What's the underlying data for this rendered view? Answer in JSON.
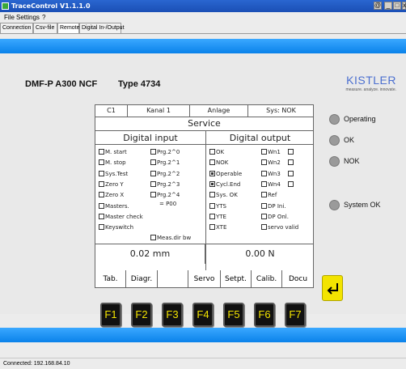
{
  "window": {
    "title": "TraceControl V1.1.1.0",
    "min_btn": "_",
    "max_btn": "□",
    "close_btn": "x",
    "sys_btn": "@"
  },
  "menu": [
    "File",
    "Settings",
    "?"
  ],
  "tabs": [
    "Connection",
    "Csv-file",
    "Remote",
    "Digital In-/Output"
  ],
  "active_tab": "Remote",
  "device": {
    "name": "DMF-P A300 NCF",
    "type": "Type 4734"
  },
  "logo": {
    "brand": "KISTLER",
    "tagline": "measure. analyze. innovate."
  },
  "lcd": {
    "header": [
      "C1",
      "Kanal 1",
      "Anlage",
      "Sys: NOK"
    ],
    "title": "Service",
    "digital_input_title": "Digital input",
    "digital_output_title": "Digital output",
    "inputs_left": [
      {
        "label": "M. start",
        "checked": false
      },
      {
        "label": "M. stop",
        "checked": false
      },
      {
        "label": "Sys.Test",
        "checked": false
      },
      {
        "label": "Zero Y",
        "checked": false
      },
      {
        "label": "Zero X",
        "checked": false
      },
      {
        "label": "Masters.",
        "checked": false
      },
      {
        "label": "Master check",
        "checked": false
      },
      {
        "label": "Keyswitch",
        "checked": false
      }
    ],
    "inputs_right": [
      {
        "label": "Prg.2^0",
        "checked": false
      },
      {
        "label": "Prg.2^1",
        "checked": false
      },
      {
        "label": "Prg.2^2",
        "checked": false
      },
      {
        "label": "Prg.2^3",
        "checked": false
      },
      {
        "label": "Prg.2^4",
        "checked": false
      }
    ],
    "masters_value": "= P00",
    "measdir": "Meas.dir bw",
    "outputs_left": [
      {
        "label": "OK",
        "checked": false
      },
      {
        "label": "NOK",
        "checked": false
      },
      {
        "label": "Operable",
        "checked": true
      },
      {
        "label": "Cycl.End",
        "checked": true
      },
      {
        "label": "Sys. OK",
        "checked": false
      },
      {
        "label": "YTS",
        "checked": false
      },
      {
        "label": "YTE",
        "checked": false
      },
      {
        "label": "XTE",
        "checked": false
      }
    ],
    "outputs_right": [
      {
        "label": "Wn1",
        "checked": false
      },
      {
        "label": "Wn2",
        "checked": false
      },
      {
        "label": "Wn3",
        "checked": false
      },
      {
        "label": "Wn4",
        "checked": false
      },
      {
        "label": "Ref",
        "checked": false
      },
      {
        "label": "DP Ini.",
        "checked": false
      },
      {
        "label": "DP Onl.",
        "checked": false
      },
      {
        "label": "servo valid",
        "checked": false
      }
    ],
    "position_value": "0.02 mm",
    "force_value": "0.00 N",
    "softkeys": [
      "Tab.",
      "Diagr.",
      "",
      "Servo",
      "Setpt.",
      "Calib.",
      "Docu"
    ]
  },
  "fkeys": [
    "F1",
    "F2",
    "F3",
    "F4",
    "F5",
    "F6",
    "F7"
  ],
  "status_leds": [
    {
      "label": "Operating",
      "color": "#9a9a9a"
    },
    {
      "label": "OK",
      "color": "#9a9a9a"
    },
    {
      "label": "NOK",
      "color": "#9a9a9a"
    },
    {
      "label": "System OK",
      "color": "#9a9a9a"
    }
  ],
  "colors": {
    "accent_blue": "#1a8ff5",
    "fkey_text": "#f3e400",
    "enter_key": "#f3e400"
  },
  "statusbar": "Connected: 192.168.84.10"
}
